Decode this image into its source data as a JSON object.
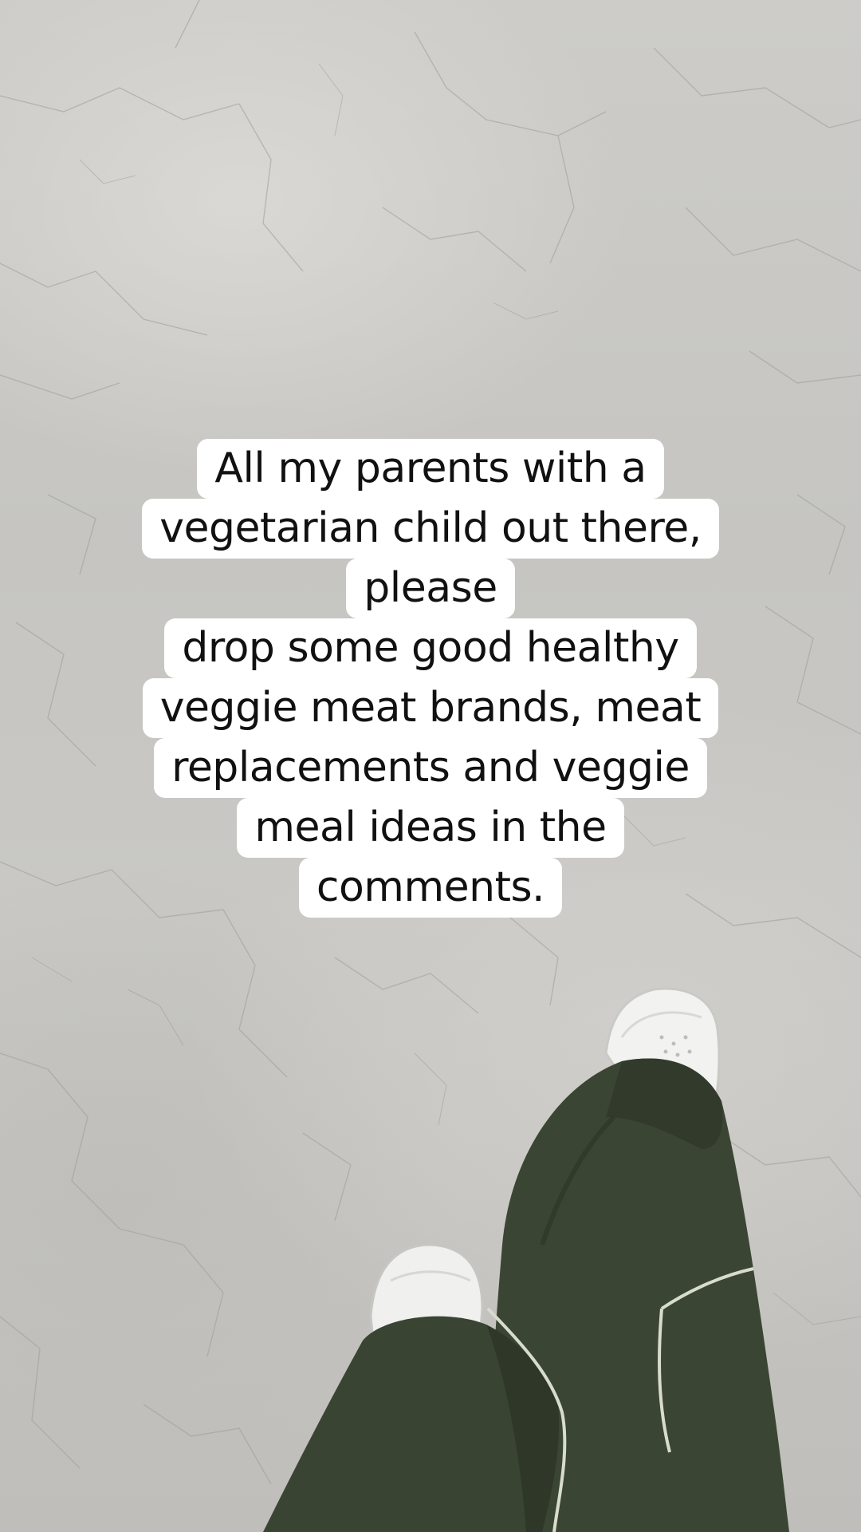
{
  "caption": {
    "lines": [
      "All my parents with a",
      "vegetarian child out there,",
      "please",
      "drop some good healthy",
      "veggie meat brands, meat",
      "replacements and veggie",
      "meal ideas in the",
      "comments."
    ]
  },
  "colors": {
    "floor": "#c8c7c3",
    "pants": "#3b4534",
    "piping": "#d8dccf",
    "shoe": "#f2f2f0",
    "caption_bg": "#ffffff",
    "caption_text": "#111111"
  }
}
